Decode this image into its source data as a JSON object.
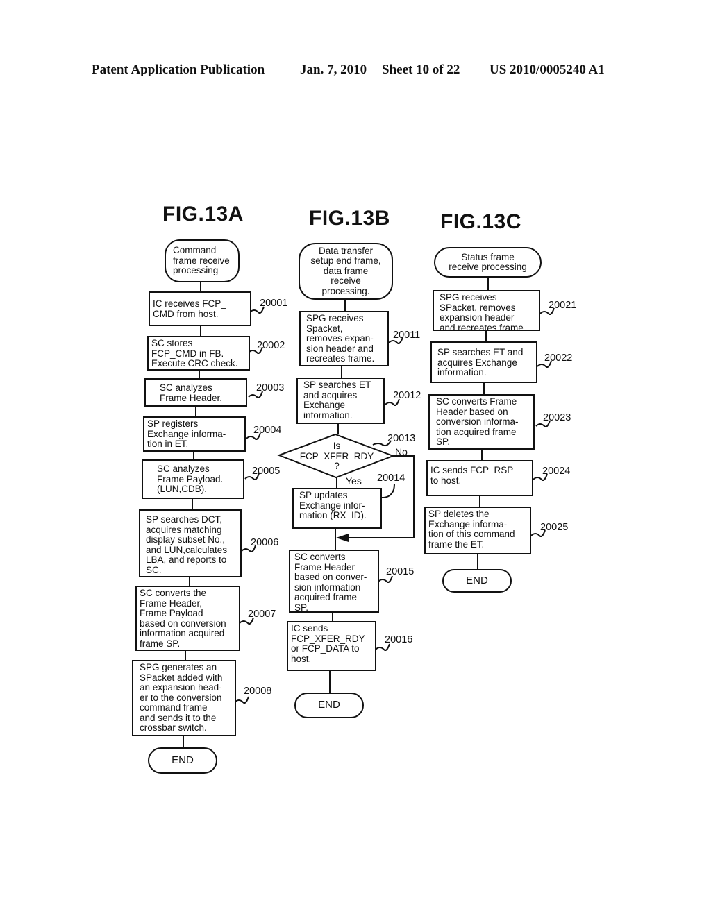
{
  "header": {
    "publication": "Patent Application Publication",
    "date": "Jan. 7, 2010",
    "sheet": "Sheet 10 of 22",
    "pub_number": "US 2010/0005240 A1"
  },
  "fig_a": {
    "title": "FIG.13A",
    "start": "Command\nframe receive\nprocessing",
    "steps": [
      {
        "ref": "20001",
        "text": "IC receives FCP_\nCMD from host."
      },
      {
        "ref": "20002",
        "text": "SC stores\nFCP_CMD in FB.\nExecute CRC check."
      },
      {
        "ref": "20003",
        "text": "SC analyzes\nFrame Header."
      },
      {
        "ref": "20004",
        "text": "SP registers\nExchange informa-\ntion in ET."
      },
      {
        "ref": "20005",
        "text": "SC analyzes\nFrame Payload.\n(LUN,CDB)."
      },
      {
        "ref": "20006",
        "text": "SP searches DCT,\nacquires matching\ndisplay subset No.,\nand LUN,calculates\nLBA, and reports to\nSC."
      },
      {
        "ref": "20007",
        "text": "SC converts the\nFrame Header,\nFrame Payload\nbased on conversion\ninformation acquired\nframe SP."
      },
      {
        "ref": "20008",
        "text": "SPG generates an\nSPacket added with\nan expansion head-\ner to the conversion\ncommand frame\nand sends it to the\ncrossbar switch."
      }
    ],
    "end": "END"
  },
  "fig_b": {
    "title": "FIG.13B",
    "start": "Data transfer\nsetup end frame,\ndata frame\nreceive\nprocessing.",
    "steps": [
      {
        "ref": "20011",
        "text": "SPG receives\nSpacket,\nremoves expan-\nsion header and\nrecreates frame."
      },
      {
        "ref": "20012",
        "text": "SP searches ET\nand acquires\nExchange\ninformation."
      }
    ],
    "decision": {
      "ref": "20013",
      "text": "Is\nFCP_XFER_RDY\n?",
      "yes": "Yes",
      "no": "No"
    },
    "steps_after": [
      {
        "ref": "20014",
        "text": "SP updates\nExchange infor-\nmation (RX_ID)."
      },
      {
        "ref": "20015",
        "text": "SC converts\nFrame Header\nbased on conver-\nsion information\nacquired frame\nSP."
      },
      {
        "ref": "20016",
        "text": "IC sends\nFCP_XFER_RDY\nor FCP_DATA to\nhost."
      }
    ],
    "end": "END"
  },
  "fig_c": {
    "title": "FIG.13C",
    "start": "Status frame\nreceive processing",
    "steps": [
      {
        "ref": "20021",
        "text": "SPG receives\nSPacket, removes\nexpansion header\nand recreates frame."
      },
      {
        "ref": "20022",
        "text": "SP searches ET and\nacquires Exchange\ninformation."
      },
      {
        "ref": "20023",
        "text": "SC converts Frame\nHeader based on\nconversion informa-\ntion acquired frame\nSP."
      },
      {
        "ref": "20024",
        "text": "IC sends FCP_RSP\nto host."
      },
      {
        "ref": "20025",
        "text": "SP deletes the\nExchange informa-\ntion of this command\nframe the ET."
      }
    ],
    "end": "END"
  }
}
